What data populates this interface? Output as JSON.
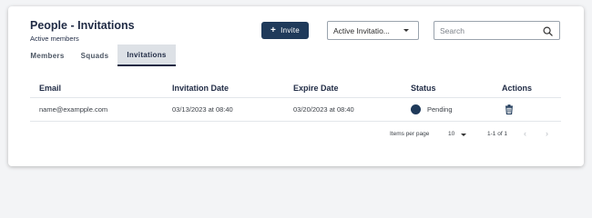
{
  "header": {
    "title": "People - Invitations",
    "subtitle": "Active members",
    "invite_label": "Invite",
    "filter_selected": "Active Invitatio...",
    "search_placeholder": "Search"
  },
  "tabs": [
    {
      "label": "Members",
      "active": false
    },
    {
      "label": "Squads",
      "active": false
    },
    {
      "label": "Invitations",
      "active": true
    }
  ],
  "table": {
    "columns": [
      "Email",
      "Invitation Date",
      "Expire Date",
      "Status",
      "Actions"
    ],
    "rows": [
      {
        "email": "name@exampple.com",
        "invitation_date": "03/13/2023 at 08:40",
        "expire_date": "03/20/2023 at 08:40",
        "status": "Pending"
      }
    ]
  },
  "pagination": {
    "items_per_page_label": "Items per page",
    "items_per_page": "10",
    "range": "1-1 of 1"
  },
  "colors": {
    "primary": "#1f3a5a",
    "heading": "#1f2a44",
    "active_tab_bg": "#dde1e6"
  },
  "icons": {
    "invite": "plus-icon",
    "filter": "chevron-down-icon",
    "search": "search-icon",
    "status": "status-dot-icon",
    "delete": "trash-icon",
    "prev": "chevron-left-icon",
    "next": "chevron-right-icon"
  }
}
